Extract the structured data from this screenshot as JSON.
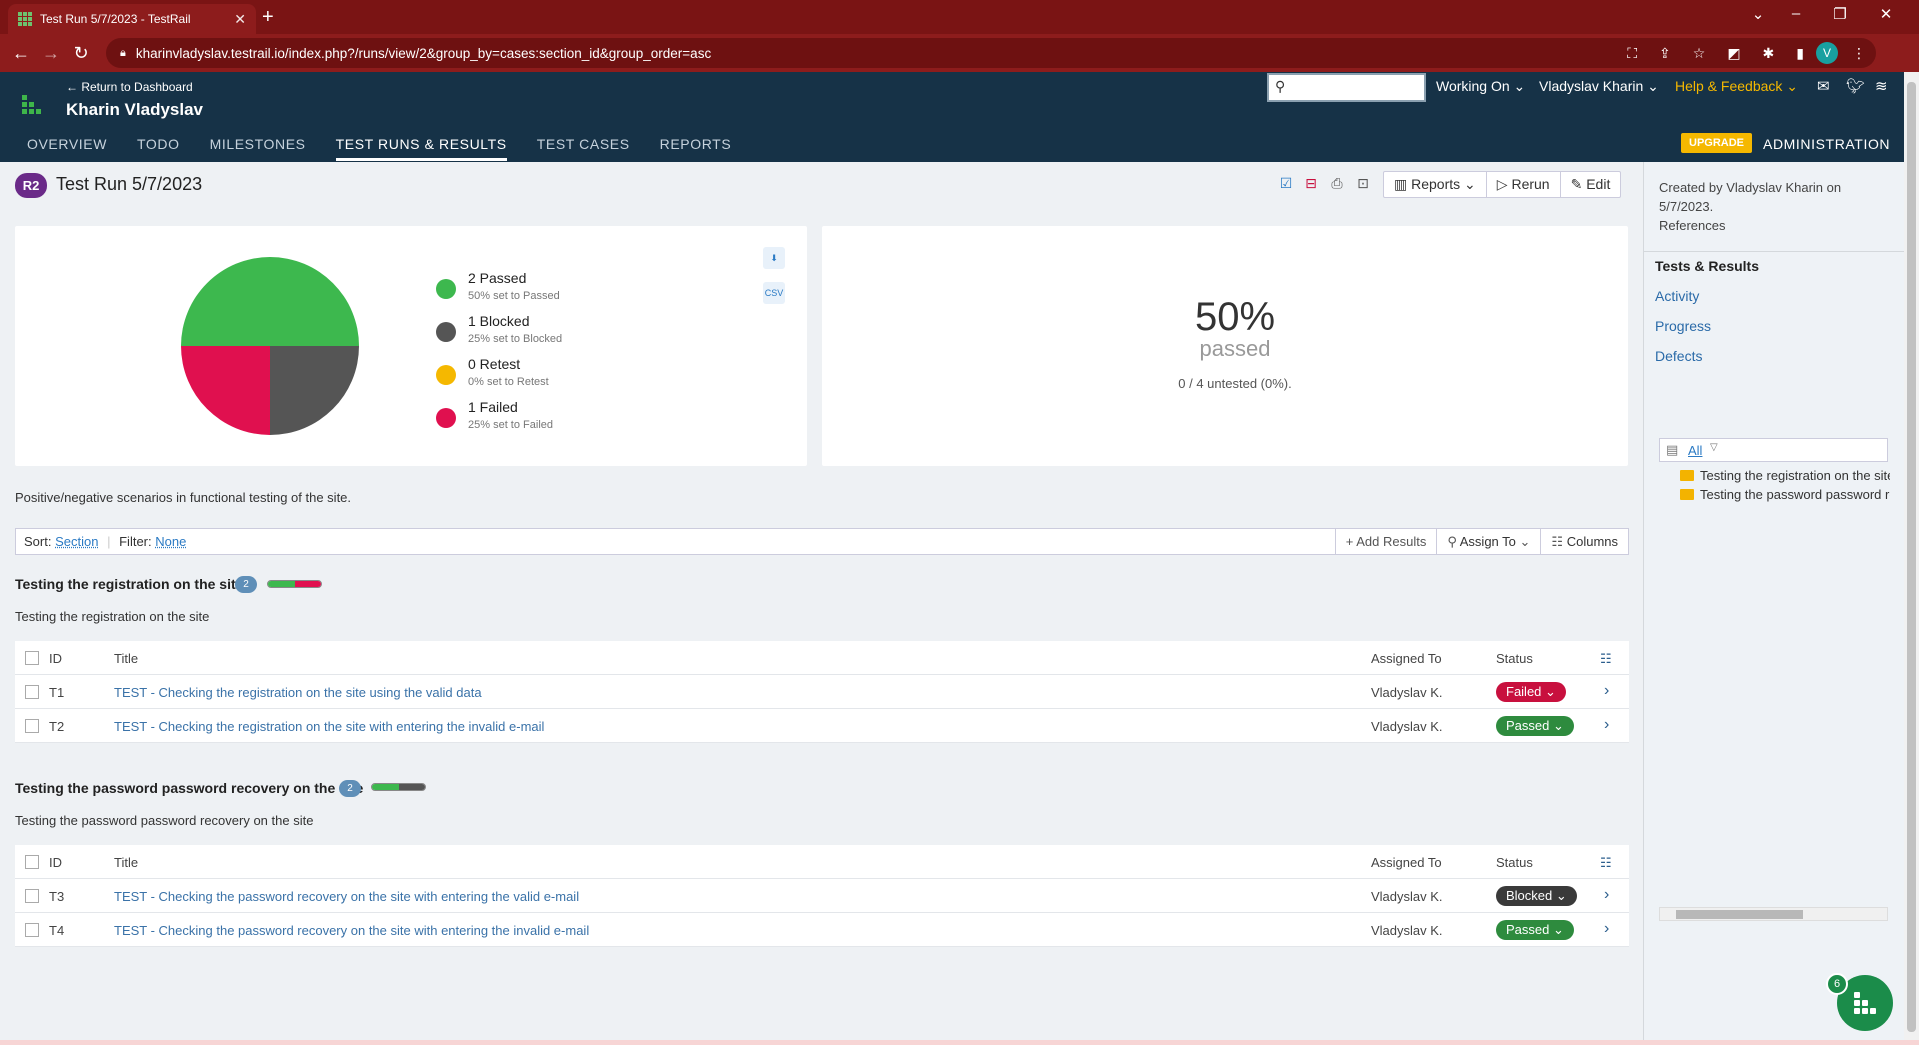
{
  "browser": {
    "tab_title": "Test Run 5/7/2023 - TestRail",
    "url": "kharinvladyslav.testrail.io/index.php?/runs/view/2&group_by=cases:section_id&group_order=asc",
    "profile_initial": "V"
  },
  "header": {
    "return_link": "← Return to Dashboard",
    "project_name": "Kharin Vladyslav",
    "working_on": "Working On",
    "user": "Vladyslav Kharin",
    "help": "Help & Feedback",
    "tabs": [
      "OVERVIEW",
      "TODO",
      "MILESTONES",
      "TEST RUNS & RESULTS",
      "TEST CASES",
      "REPORTS"
    ],
    "upgrade": "UPGRADE",
    "administration": "ADMINISTRATION"
  },
  "run": {
    "badge": "R2",
    "title": "Test Run 5/7/2023",
    "reports": "Reports",
    "rerun": "Rerun",
    "edit": "Edit"
  },
  "chart_data": {
    "type": "pie",
    "categories": [
      "Passed",
      "Blocked",
      "Retest",
      "Failed"
    ],
    "values": [
      2,
      1,
      0,
      1
    ],
    "colors": [
      "#3db84e",
      "#555555",
      "#f5b800",
      "#e0104f"
    ]
  },
  "legend": [
    {
      "name": "2 Passed",
      "sub": "50% set to Passed"
    },
    {
      "name": "1 Blocked",
      "sub": "25% set to Blocked"
    },
    {
      "name": "0 Retest",
      "sub": "0% set to Retest"
    },
    {
      "name": "1 Failed",
      "sub": "25% set to Failed"
    }
  ],
  "summary": {
    "percent": "50%",
    "percent_label": "passed",
    "untested": "0 / 4 untested (0%)."
  },
  "description": "Positive/negative scenarios in functional testing of the site.",
  "filterbar": {
    "sort_label": "Sort:",
    "sort_value": "Section",
    "filter_label": "Filter:",
    "filter_value": "None",
    "add_results": "Add Results",
    "assign_to": "Assign To",
    "columns": "Columns"
  },
  "columns": {
    "id": "ID",
    "title": "Title",
    "assigned": "Assigned To",
    "status": "Status"
  },
  "sections": [
    {
      "title": "Testing the registration on the site",
      "count": "2",
      "desc": "Testing the registration on the site",
      "rows": [
        {
          "id": "T1",
          "title": "TEST - Checking the registration on the site using the valid data",
          "assigned": "Vladyslav K.",
          "status": "Failed"
        },
        {
          "id": "T2",
          "title": "TEST - Checking the registration on the site with entering the invalid e-mail",
          "assigned": "Vladyslav K.",
          "status": "Passed"
        }
      ]
    },
    {
      "title": "Testing the password password recovery on the site",
      "count": "2",
      "desc": "Testing the password password recovery on the site",
      "rows": [
        {
          "id": "T3",
          "title": "TEST - Checking the password recovery on the site with entering the valid e-mail",
          "assigned": "Vladyslav K.",
          "status": "Blocked"
        },
        {
          "id": "T4",
          "title": "TEST - Checking the password recovery on the site with entering the invalid e-mail",
          "assigned": "Vladyslav K.",
          "status": "Passed"
        }
      ]
    }
  ],
  "status_colors": {
    "Failed": "#c8103e",
    "Passed": "#2e8b3e",
    "Blocked": "#3a3a3a"
  },
  "sidebar": {
    "created_by": "Created by Vladyslav Kharin on 5/7/2023.",
    "references": "References",
    "links": [
      "Tests & Results",
      "Activity",
      "Progress",
      "Defects"
    ],
    "tree_all": "All",
    "tree_items": [
      "Testing the registration on the site",
      "Testing the password password recovery on the site"
    ]
  },
  "fab_count": "6"
}
